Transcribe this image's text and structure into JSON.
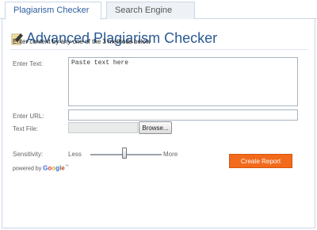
{
  "tabs": [
    {
      "label": "Plagiarism Checker",
      "active": true
    },
    {
      "label": "Search Engine Reports",
      "active": false
    }
  ],
  "header": {
    "title": "Advanced Plagiarism Checker",
    "icon": "pencil-note-icon"
  },
  "instructions": "Enter content by any one of the 3 methods below",
  "form": {
    "text_label": "Enter Text:",
    "text_value": "Paste text here",
    "url_label": "Enter URL:",
    "url_value": "",
    "file_label": "Text File:",
    "browse_label": "Browse..."
  },
  "sensitivity": {
    "label": "Sensitivity:",
    "less": "Less",
    "more": "More",
    "level": 0.5
  },
  "powered_by": {
    "prefix": "powered by",
    "brand": "Google",
    "tm": "™"
  },
  "actions": {
    "create_report": "Create Report"
  },
  "colors": {
    "accent": "#f26a1b",
    "title": "#2a5a93",
    "tab_border": "#c9d8e6"
  }
}
